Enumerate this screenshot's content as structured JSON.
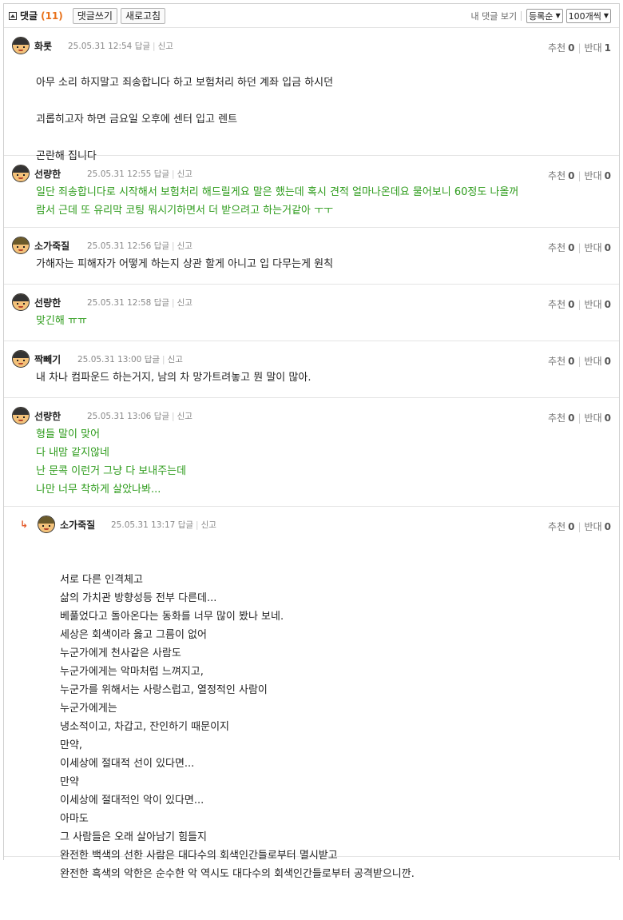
{
  "header": {
    "title": "댓글",
    "count": "(11)",
    "write_btn": "댓글쓰기",
    "refresh_btn": "새로고침",
    "my_comments": "내 댓글 보기",
    "sort_select": "등록순",
    "per_page_select": "100개씩"
  },
  "labels": {
    "reply": "답글",
    "report": "신고",
    "up": "추천",
    "down": "반대"
  },
  "comments": [
    {
      "nick": "화롯",
      "date": "25.05.31 12:54",
      "up": "0",
      "down": "1",
      "lines": [
        "아무 소리 하지말고 죄송합니다 하고 보험처리 하던 계좌 입금 하시던",
        "",
        "괴롭히고자 하면 금요일 오후에 센터 입고 렌트",
        "",
        "곤란해 집니다"
      ]
    },
    {
      "nick": "선량한",
      "date": "25.05.31 12:55",
      "up": "0",
      "down": "0",
      "lines": [
        "일단 죄송합니다로 시작해서 보험처리 해드릴게요 말은 했는데 혹시 견적 얼마나온데요 물어보니 60정도 나올꺼",
        "람서 근데 또 유리막 코팅 뭐시기하면서 더 받으려고 하는거같아 ㅜㅜ"
      ]
    },
    {
      "nick": "소가죽질",
      "date": "25.05.31 12:56",
      "up": "0",
      "down": "0",
      "lines": [
        "가해자는 피해자가 어떻게 하는지 상관 할게 아니고 입 다무는게 원칙"
      ]
    },
    {
      "nick": "선량한",
      "date": "25.05.31 12:58",
      "up": "0",
      "down": "0",
      "lines": [
        "맞긴해 ㅠㅠ"
      ]
    },
    {
      "nick": "짝빼기",
      "date": "25.05.31 13:00",
      "up": "0",
      "down": "0",
      "lines": [
        "내 차나 컴파운드 하는거지, 남의 차 망가트려놓고 뭔 말이 많아."
      ]
    },
    {
      "nick": "선량한",
      "date": "25.05.31 13:06",
      "up": "0",
      "down": "0",
      "lines": [
        "형들 말이 맞어",
        "다 내맘 같지않네",
        "난 문콕 이런거 그냥 다 보내주는데",
        "나만 너무 착하게 살았나봐..."
      ]
    },
    {
      "nick": "소가죽질",
      "date": "25.05.31 13:17",
      "up": "0",
      "down": "0",
      "reply_arrow": "↳",
      "lines": [
        "서로 다른 인격체고",
        "삶의 가치관 방향성등 전부 다른데...",
        "베풀었다고 돌아온다는 동화를 너무 많이 봤나 보네.",
        "세상은 회색이라 옳고 그름이 없어",
        "누군가에게 천사같은 사람도",
        "누군가에게는 악마처럼 느껴지고,",
        "누군가를 위해서는 사랑스럽고, 열정적인 사람이",
        "누군가에게는",
        "냉소적이고, 차갑고, 잔인하기 때문이지",
        "만약,",
        "이세상에 절대적 선이 있다면...",
        "만약",
        "이세상에 절대적인 악이 있다면...",
        "아마도",
        "그 사람들은 오래 살아남기 힘들지",
        "완전한 백색의 선한 사람은 대다수의 회색인간들로부터 멸시받고",
        "완전한 흑색의 악한은 순수한 악 역시도 대다수의 회색인간들로부터 공격받으니깐."
      ]
    }
  ]
}
